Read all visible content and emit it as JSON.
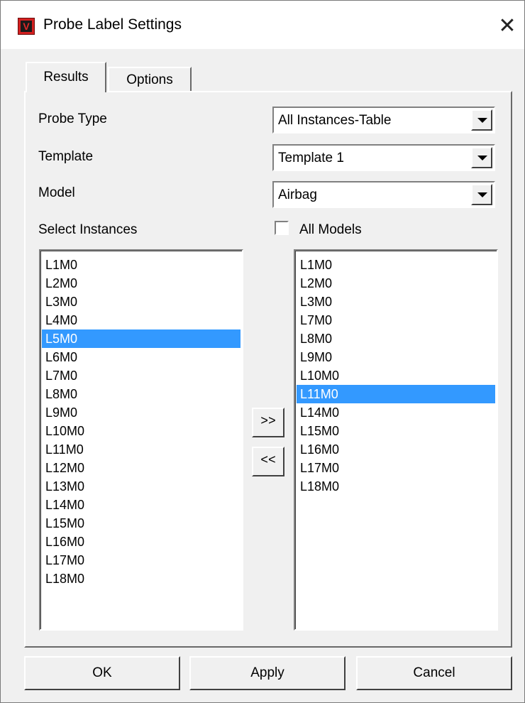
{
  "window": {
    "title": "Probe Label Settings",
    "icon": "app-logo-icon"
  },
  "tabs": [
    {
      "label": "Results",
      "active": true
    },
    {
      "label": "Options",
      "active": false
    }
  ],
  "fields": {
    "probe_type": {
      "label": "Probe Type",
      "value": "All Instances-Table"
    },
    "template": {
      "label": "Template",
      "value": "Template 1"
    },
    "model": {
      "label": "Model",
      "value": "Airbag"
    }
  },
  "select_instances_label": "Select Instances",
  "all_models": {
    "label": "All Models",
    "checked": false
  },
  "left_list": {
    "items": [
      "L1M0",
      "L2M0",
      "L3M0",
      "L4M0",
      "L5M0",
      "L6M0",
      "L7M0",
      "L8M0",
      "L9M0",
      "L10M0",
      "L11M0",
      "L12M0",
      "L13M0",
      "L14M0",
      "L15M0",
      "L16M0",
      "L17M0",
      "L18M0"
    ],
    "selected": "L5M0"
  },
  "right_list": {
    "items": [
      "L1M0",
      "L2M0",
      "L3M0",
      "L7M0",
      "L8M0",
      "L9M0",
      "L10M0",
      "L11M0",
      "L14M0",
      "L15M0",
      "L16M0",
      "L17M0",
      "L18M0"
    ],
    "selected": "L11M0"
  },
  "move_buttons": {
    "add": ">>",
    "remove": "<<"
  },
  "buttons": {
    "ok": "OK",
    "apply": "Apply",
    "cancel": "Cancel"
  },
  "colors": {
    "selection": "#3399ff",
    "icon_red": "#d32020"
  }
}
